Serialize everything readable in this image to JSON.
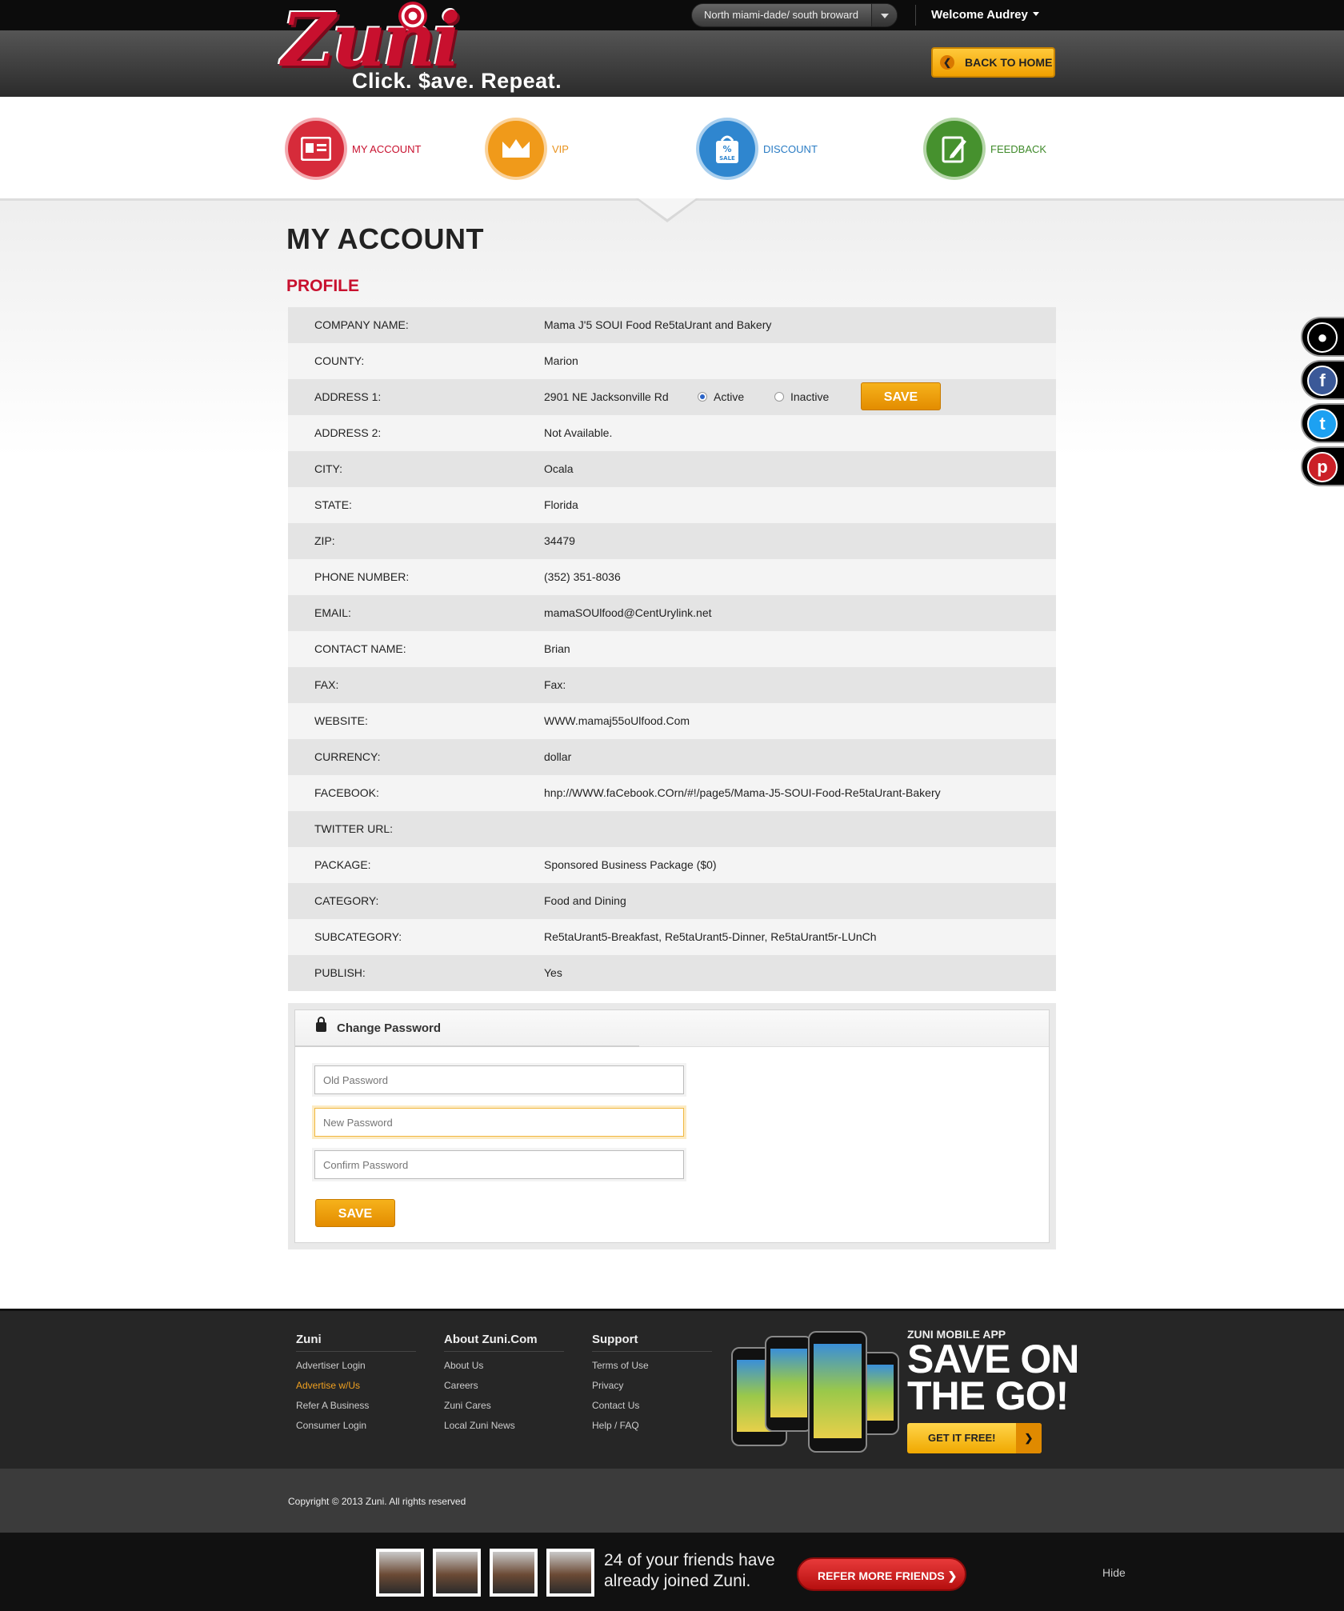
{
  "header": {
    "logo_text": "Zuni",
    "tagline": "Click. $ave. Repeat.",
    "region": "North miami-dade/ south broward",
    "welcome": "Welcome Audrey",
    "back_button": "BACK TO HOME"
  },
  "nav": [
    {
      "label": "MY ACCOUNT",
      "icon": "id-card-icon",
      "color": "#c8102e"
    },
    {
      "label": "VIP",
      "icon": "crown-icon",
      "color": "#e8921c"
    },
    {
      "label": "DISCOUNT",
      "icon": "sale-tag-icon",
      "color": "#2a7cc4"
    },
    {
      "label": "FEEDBACK",
      "icon": "notepad-icon",
      "color": "#3f8a2a"
    }
  ],
  "page": {
    "title": "MY ACCOUNT",
    "section": "PROFILE"
  },
  "profile": [
    {
      "label": "COMPANY NAME:",
      "value": "Mama J'5 SOUI Food Re5taUrant and Bakery"
    },
    {
      "label": "COUNTY:",
      "value": "Marion"
    },
    {
      "label": "ADDRESS 1:",
      "value": "2901 NE Jacksonville Rd"
    },
    {
      "label": "ADDRESS 2:",
      "value": "Not Available."
    },
    {
      "label": "CITY:",
      "value": "Ocala"
    },
    {
      "label": "STATE:",
      "value": "Florida"
    },
    {
      "label": "ZIP:",
      "value": "34479"
    },
    {
      "label": "PHONE NUMBER:",
      "value": "(352) 351-8036"
    },
    {
      "label": "EMAIL:",
      "value": "mamaSOUlfood@CentUrylink.net"
    },
    {
      "label": "CONTACT NAME:",
      "value": "Brian"
    },
    {
      "label": "FAX:",
      "value": "Fax:"
    },
    {
      "label": "WEBSITE:",
      "value": "WWW.mamaj55oUlfood.Com"
    },
    {
      "label": "CURRENCY:",
      "value": "dollar"
    },
    {
      "label": "FACEBOOK:",
      "value": "hnp://WWW.faCebook.COrn/#!/page5/Mama-J5-SOUI-Food-Re5taUrant-Bakery"
    },
    {
      "label": "TWITTER URL:",
      "value": ""
    },
    {
      "label": "PACKAGE:",
      "value": "Sponsored Business Package ($0)"
    },
    {
      "label": "CATEGORY:",
      "value": "Food and Dining"
    },
    {
      "label": "SUBCATEGORY:",
      "value": "Re5taUrant5-Breakfast, Re5taUrant5-Dinner, Re5taUrant5r-LUnCh"
    },
    {
      "label": "PUBLISH:",
      "value": "Yes"
    }
  ],
  "status": {
    "active_label": "Active",
    "inactive_label": "Inactive",
    "selected": "Active",
    "save_label": "SAVE"
  },
  "password": {
    "title": "Change Password",
    "old_placeholder": "Old Password",
    "new_placeholder": "New Password",
    "confirm_placeholder": "Confirm Password",
    "save_label": "SAVE"
  },
  "footer": {
    "columns": [
      {
        "heading": "Zuni",
        "links": [
          "Advertiser Login",
          "Advertise w/Us",
          "Refer A Business",
          "Consumer Login"
        ]
      },
      {
        "heading": "About Zuni.Com",
        "links": [
          "About Us",
          "Careers",
          "Zuni Cares",
          "Local Zuni News"
        ]
      },
      {
        "heading": "Support",
        "links": [
          "Terms of Use",
          "Privacy",
          "Contact Us",
          "Help / FAQ"
        ]
      }
    ],
    "app_kicker": "ZUNI MOBILE APP",
    "app_headline_1": "SAVE ON",
    "app_headline_2": "THE GO!",
    "app_button": "GET IT FREE!",
    "copyright": "Copyright © 2013 Zuni. All rights reserved"
  },
  "referral": {
    "text_1": "24 of your friends have",
    "text_2": "already joined Zuni.",
    "button": "REFER MORE FRIENDS",
    "hide": "Hide"
  },
  "social": [
    {
      "icon": "friends-icon",
      "color": "#000000"
    },
    {
      "icon": "facebook-icon",
      "color": "#3b5998"
    },
    {
      "icon": "twitter-icon",
      "color": "#1da1f2"
    },
    {
      "icon": "pinterest-icon",
      "color": "#cb2027"
    }
  ]
}
